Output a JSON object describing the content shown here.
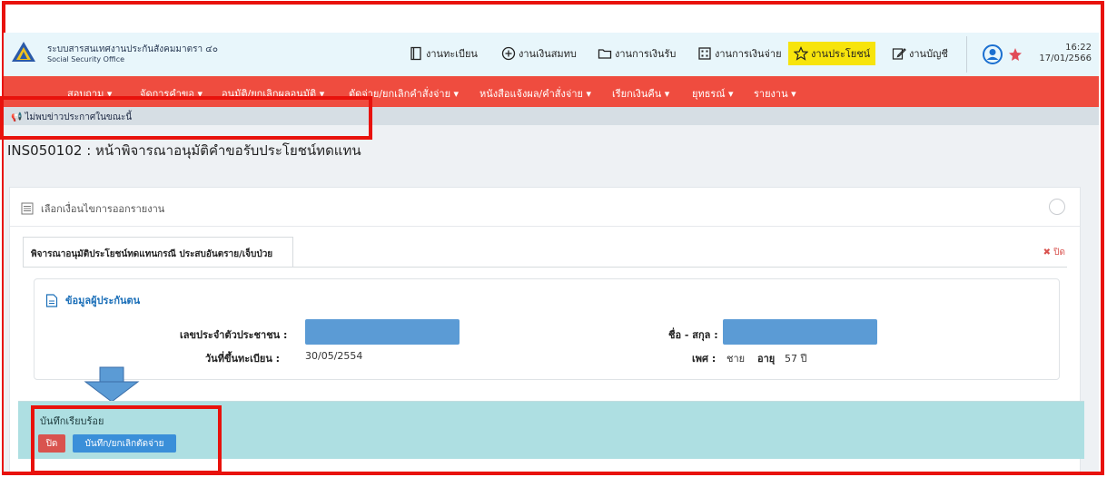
{
  "header": {
    "app_name_th": "ระบบสารสนเทศงานประกันสังคมมาตรา ๔๐",
    "app_name_en": "Social Security Office",
    "nav": [
      {
        "label": "งานทะเบียน",
        "icon": "book-icon"
      },
      {
        "label": "งานเงินสมทบ",
        "icon": "plus-circle-icon"
      },
      {
        "label": "งานการเงินรับ",
        "icon": "folder-icon"
      },
      {
        "label": "งานการเงินจ่าย",
        "icon": "calculator-icon"
      },
      {
        "label": "งานประโยชน์",
        "icon": "star-icon",
        "active": true
      },
      {
        "label": "งานบัญชี",
        "icon": "edit-icon"
      }
    ],
    "time": "16:22",
    "date": "17/01/2566"
  },
  "submenu": [
    "สอบถาม ▾",
    "จัดการคำขอ ▾",
    "อนุมัติ/ยกเลิกผลอนุมัติ ▾",
    "ตัดจ่าย/ยกเลิกคำสั่งจ่าย ▾",
    "หนังสือแจ้งผล/คำสั่งจ่าย ▾",
    "เรียกเงินคืน ▾",
    "ยุทธรณ์ ▾",
    "รายงาน ▾"
  ],
  "news": "ไม่พบข่าวประกาศในขณะนี้",
  "page": {
    "title": "INS050102 : หน้าพิจารณาอนุมัติคำขอรับประโยชน์ทดแทน"
  },
  "panel": {
    "heading": "เลือกเงื่อนไขการออกรายงาน",
    "tab_label": "พิจารณาอนุมัติประโยชน์ทดแทนกรณี ประสบอันตราย/เจ็บป่วย",
    "close_label": "✖ ปิด",
    "info": {
      "heading": "ข้อมูลผู้ประกันตน",
      "id_label": "เลขประจำตัวประชาชน :",
      "name_label": "ชื่อ - สกุล :",
      "reg_date_label": "วันที่ขึ้นทะเบียน :",
      "reg_date_value": "30/05/2554",
      "gender_label": "เพศ :",
      "gender_value": "ชาย",
      "age_label": "อายุ",
      "age_value": "57 ปี"
    }
  },
  "alert": {
    "message": "บันทึกเรียบร้อย",
    "close_button": "ปิด",
    "save_button": "บันทึก/ยกเลิกตัดจ่าย"
  },
  "colors": {
    "highlight": "#e8120c",
    "submenu_bg": "#ef4c3f",
    "active_nav": "#f7e40c",
    "alert_bg": "#aedfe2",
    "masked_field": "#5b9bd5"
  }
}
